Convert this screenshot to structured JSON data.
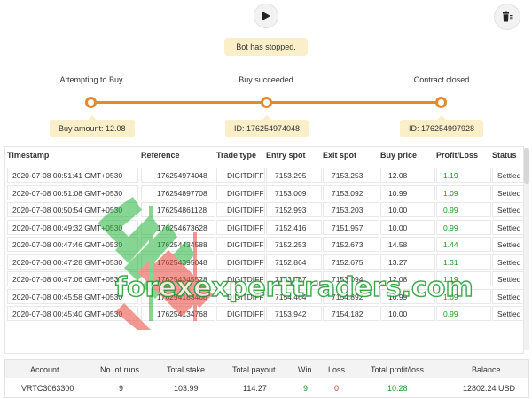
{
  "controls": {
    "play_icon": "play-icon",
    "clear_icon": "clear-stats-icon"
  },
  "status": "Bot has stopped.",
  "flow": {
    "steps": [
      {
        "label": "Attempting to Buy",
        "bubble": "Buy amount: 12.08"
      },
      {
        "label": "Buy succeeded",
        "bubble": "ID: 176254974048"
      },
      {
        "label": "Contract closed",
        "bubble": "ID: 176254997928"
      }
    ],
    "accent": "#e58a2c"
  },
  "transactions": {
    "columns": [
      "Timestamp",
      "Reference",
      "Trade type",
      "Entry spot",
      "Exit spot",
      "Buy price",
      "Profit/Loss",
      "Status"
    ],
    "rows": [
      {
        "timestamp": "2020-07-08 00:51:41 GMT+0530",
        "reference": "176254974048",
        "trade_type": "DIGITDIFF",
        "entry_spot": "7153.295",
        "exit_spot": "7153.253",
        "buy_price": "12.08",
        "profit_loss": "1.19",
        "status": "Settled"
      },
      {
        "timestamp": "2020-07-08 00:51:08 GMT+0530",
        "reference": "176254897708",
        "trade_type": "DIGITDIFF",
        "entry_spot": "7153.009",
        "exit_spot": "7153.092",
        "buy_price": "10.99",
        "profit_loss": "1.09",
        "status": "Settled"
      },
      {
        "timestamp": "2020-07-08 00:50:54 GMT+0530",
        "reference": "176254861128",
        "trade_type": "DIGITDIFF",
        "entry_spot": "7152.993",
        "exit_spot": "7153.203",
        "buy_price": "10.00",
        "profit_loss": "0.99",
        "status": "Settled"
      },
      {
        "timestamp": "2020-07-08 00:49:32 GMT+0530",
        "reference": "176254673628",
        "trade_type": "DIGITDIFF",
        "entry_spot": "7152.416",
        "exit_spot": "7151.957",
        "buy_price": "10.00",
        "profit_loss": "0.99",
        "status": "Settled"
      },
      {
        "timestamp": "2020-07-08 00:47:46 GMT+0530",
        "reference": "176254434588",
        "trade_type": "DIGITDIFF",
        "entry_spot": "7152.253",
        "exit_spot": "7152.673",
        "buy_price": "14.58",
        "profit_loss": "1.44",
        "status": "Settled"
      },
      {
        "timestamp": "2020-07-08 00:47:28 GMT+0530",
        "reference": "176254395048",
        "trade_type": "DIGITDIFF",
        "entry_spot": "7152.864",
        "exit_spot": "7152.675",
        "buy_price": "13.27",
        "profit_loss": "1.31",
        "status": "Settled"
      },
      {
        "timestamp": "2020-07-08 00:47:06 GMT+0530",
        "reference": "176254345528",
        "trade_type": "DIGITDIFF",
        "entry_spot": "7153.437",
        "exit_spot": "7153.094",
        "buy_price": "12.08",
        "profit_loss": "1.19",
        "status": "Settled"
      },
      {
        "timestamp": "2020-07-08 00:45:58 GMT+0530",
        "reference": "176254183468",
        "trade_type": "DIGITDIFF",
        "entry_spot": "7154.464",
        "exit_spot": "7154.892",
        "buy_price": "10.99",
        "profit_loss": "1.09",
        "status": "Settled"
      },
      {
        "timestamp": "2020-07-08 00:45:40 GMT+0530",
        "reference": "176254134768",
        "trade_type": "DIGITDIFF",
        "entry_spot": "7153.942",
        "exit_spot": "7154.182",
        "buy_price": "10.00",
        "profit_loss": "0.99",
        "status": "Settled"
      }
    ]
  },
  "summary": {
    "columns": [
      "Account",
      "No. of runs",
      "Total stake",
      "Total payout",
      "Win",
      "Loss",
      "Total profit/loss",
      "Balance"
    ],
    "values": {
      "account": "VRTC3063300",
      "runs": "9",
      "total_stake": "103.99",
      "total_payout": "114.27",
      "win": "9",
      "loss": "0",
      "total_profit_loss": "10.28",
      "balance": "12802.24 USD"
    }
  },
  "watermark": "forexexperttraders.com",
  "colors": {
    "profit": "#1a9a2a",
    "loss": "#d43a2f",
    "pill": "#fbefc9"
  }
}
